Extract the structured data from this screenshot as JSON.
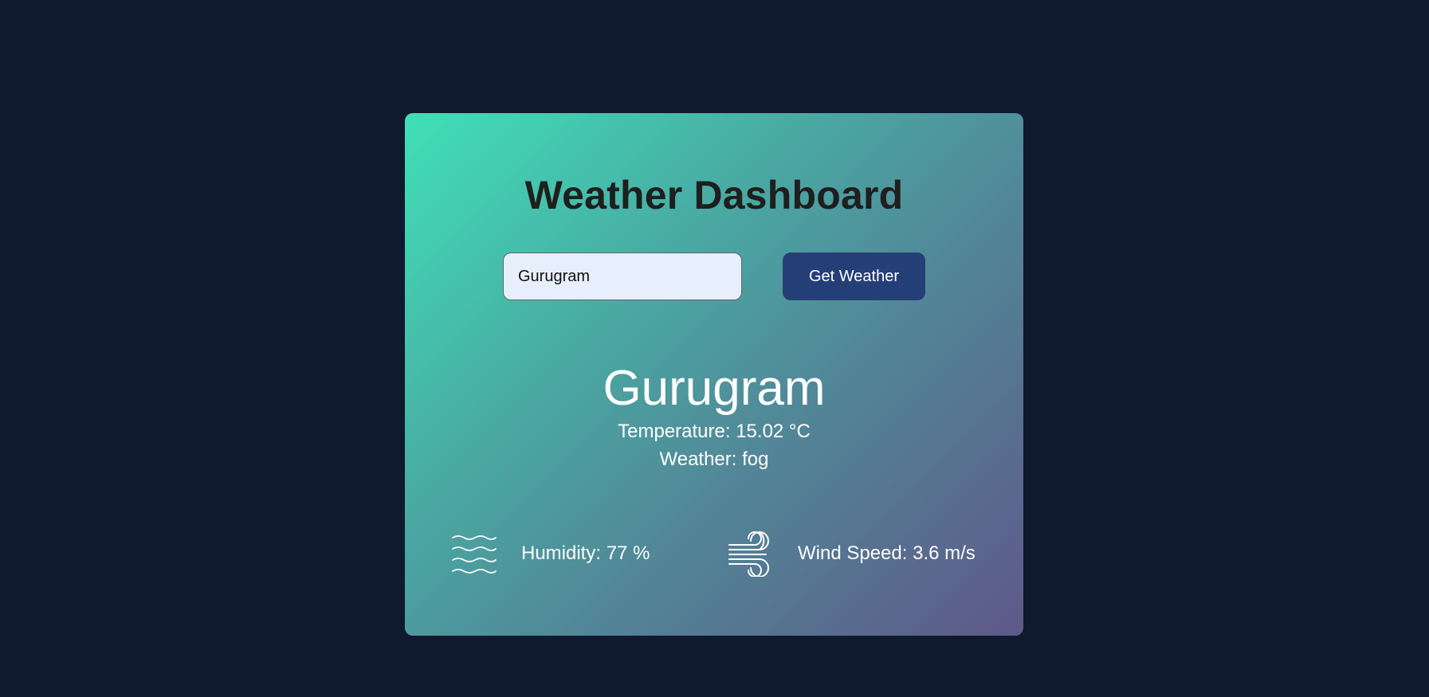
{
  "app": {
    "title": "Weather Dashboard"
  },
  "search": {
    "value": "Gurugram",
    "button_label": "Get Weather"
  },
  "weather": {
    "city": "Gurugram",
    "temperature_label": "Temperature:",
    "temperature_value": "15.02 °C",
    "condition_label": "Weather:",
    "condition_value": "fog"
  },
  "details": {
    "humidity": {
      "icon": "waves-icon",
      "label": "Humidity:",
      "value": "77",
      "unit": "%"
    },
    "wind": {
      "icon": "wind-icon",
      "label": "Wind Speed:",
      "value": "3.6",
      "unit": "m/s"
    }
  },
  "colors": {
    "page_background": "#0f1a2e",
    "card_gradient_start": "#3fe0b7",
    "card_gradient_end": "#5e5889",
    "button_background": "#243f78",
    "input_background": "#e8effc",
    "title_color": "#1e1f1e"
  }
}
